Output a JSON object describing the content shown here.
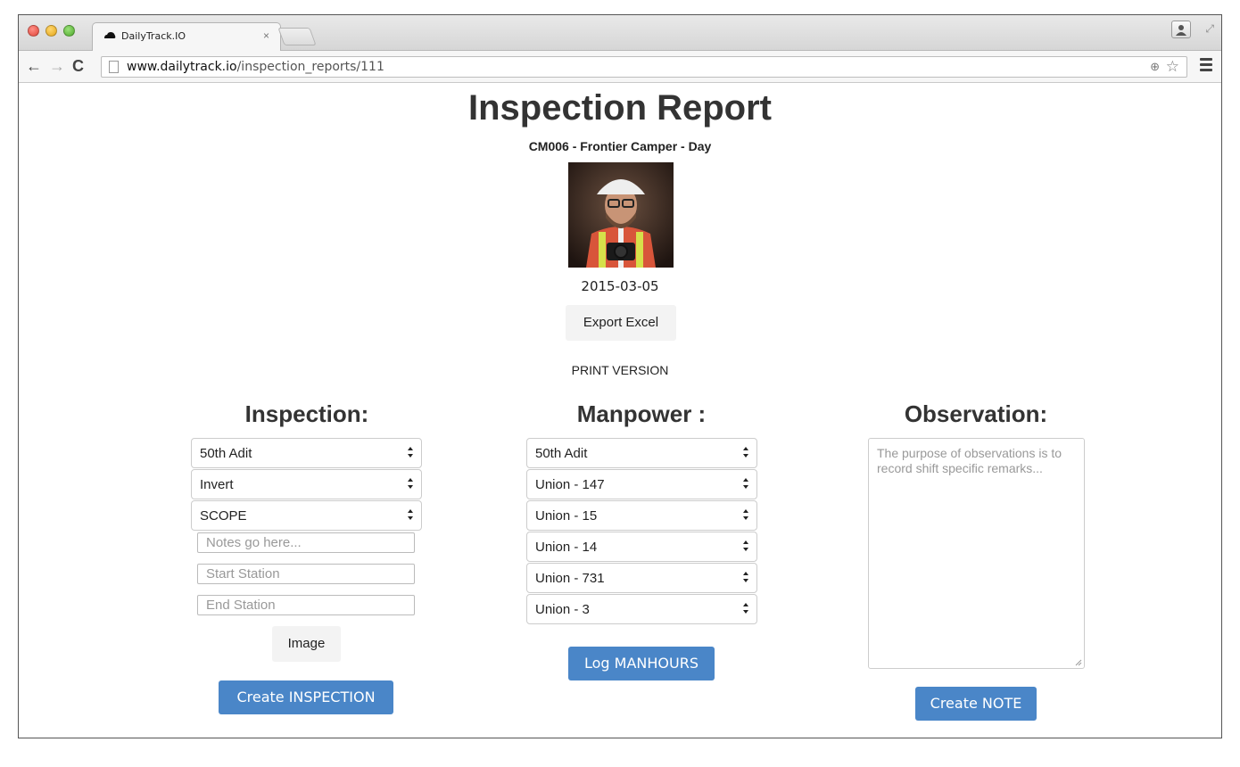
{
  "browser": {
    "tab_title": "DailyTrack.IO",
    "tab_close": "×",
    "url_host": "www.dailytrack.io",
    "url_path": "/inspection_reports/111",
    "icons": [
      "close-traffic-icon",
      "minimize-traffic-icon",
      "zoom-traffic-icon",
      "cloud-favicon-icon",
      "back-arrow-icon",
      "forward-arrow-icon",
      "reload-icon",
      "page-icon",
      "zoom-icon",
      "star-icon",
      "menu-icon",
      "profile-icon",
      "fullscreen-icon"
    ]
  },
  "report": {
    "title": "Inspection Report",
    "subtitle": "CM006 - Frontier Camper - Day",
    "date": "2015-03-05",
    "export_label": "Export Excel",
    "print_label": "PRINT VERSION"
  },
  "inspection": {
    "heading": "Inspection:",
    "selects": [
      "50th Adit",
      "Invert",
      "SCOPE"
    ],
    "notes_placeholder": "Notes go here...",
    "start_placeholder": "Start Station",
    "end_placeholder": "End Station",
    "image_label": "Image",
    "create_label": "Create INSPECTION"
  },
  "manpower": {
    "heading": "Manpower :",
    "selects": [
      "50th Adit",
      "Union - 147",
      "Union - 15",
      "Union - 14",
      "Union - 731",
      "Union - 3"
    ],
    "log_label": "Log MANHOURS"
  },
  "observation": {
    "heading": "Observation:",
    "placeholder": "The purpose of observations is to record shift specific remarks...",
    "create_label": "Create NOTE"
  },
  "colors": {
    "primary": "#4a86c8",
    "default_button": "#f3f3f3",
    "text": "#333333"
  }
}
